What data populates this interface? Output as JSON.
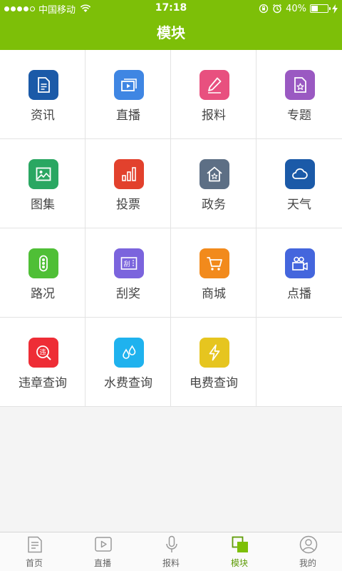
{
  "status_bar": {
    "carrier": "中国移动",
    "time": "17:18",
    "battery": "40%",
    "battery_level": 0.4
  },
  "header": {
    "title": "模块"
  },
  "modules": [
    {
      "label": "资讯",
      "icon": "document-icon",
      "color": "#1b5aa8"
    },
    {
      "label": "直播",
      "icon": "live-video-icon",
      "color": "#3f86e3"
    },
    {
      "label": "报料",
      "icon": "pencil-icon",
      "color": "#e8507f"
    },
    {
      "label": "专题",
      "icon": "star-file-icon",
      "color": "#9a59c2"
    },
    {
      "label": "图集",
      "icon": "image-icon",
      "color": "#2aa762"
    },
    {
      "label": "投票",
      "icon": "bar-chart-icon",
      "color": "#e2412d"
    },
    {
      "label": "政务",
      "icon": "house-star-icon",
      "color": "#5d6f85"
    },
    {
      "label": "天气",
      "icon": "cloud-icon",
      "color": "#1b5aa8"
    },
    {
      "label": "路况",
      "icon": "traffic-light-icon",
      "color": "#4fbf36"
    },
    {
      "label": "刮奖",
      "icon": "scratch-card-icon",
      "color": "#7b64dd"
    },
    {
      "label": "商城",
      "icon": "cart-icon",
      "color": "#f28a1c"
    },
    {
      "label": "点播",
      "icon": "video-camera-icon",
      "color": "#4466dd"
    },
    {
      "label": "违章查询",
      "icon": "violation-search-icon",
      "color": "#ee2d36"
    },
    {
      "label": "水费查询",
      "icon": "water-drop-icon",
      "color": "#1fb2ee"
    },
    {
      "label": "电费查询",
      "icon": "lightning-icon",
      "color": "#e6c51f"
    }
  ],
  "scratch_card_char": "刮",
  "violation_char": "违",
  "tabs": [
    {
      "label": "首页",
      "icon": "home-doc-icon",
      "active": false
    },
    {
      "label": "直播",
      "icon": "play-icon",
      "active": false
    },
    {
      "label": "报料",
      "icon": "microphone-icon",
      "active": false
    },
    {
      "label": "模块",
      "icon": "module-icon",
      "active": true
    },
    {
      "label": "我的",
      "icon": "user-icon",
      "active": false
    }
  ],
  "colors": {
    "brand": "#7dbf08",
    "tab_active": "#5f9c08",
    "tab_inactive": "#999999"
  }
}
